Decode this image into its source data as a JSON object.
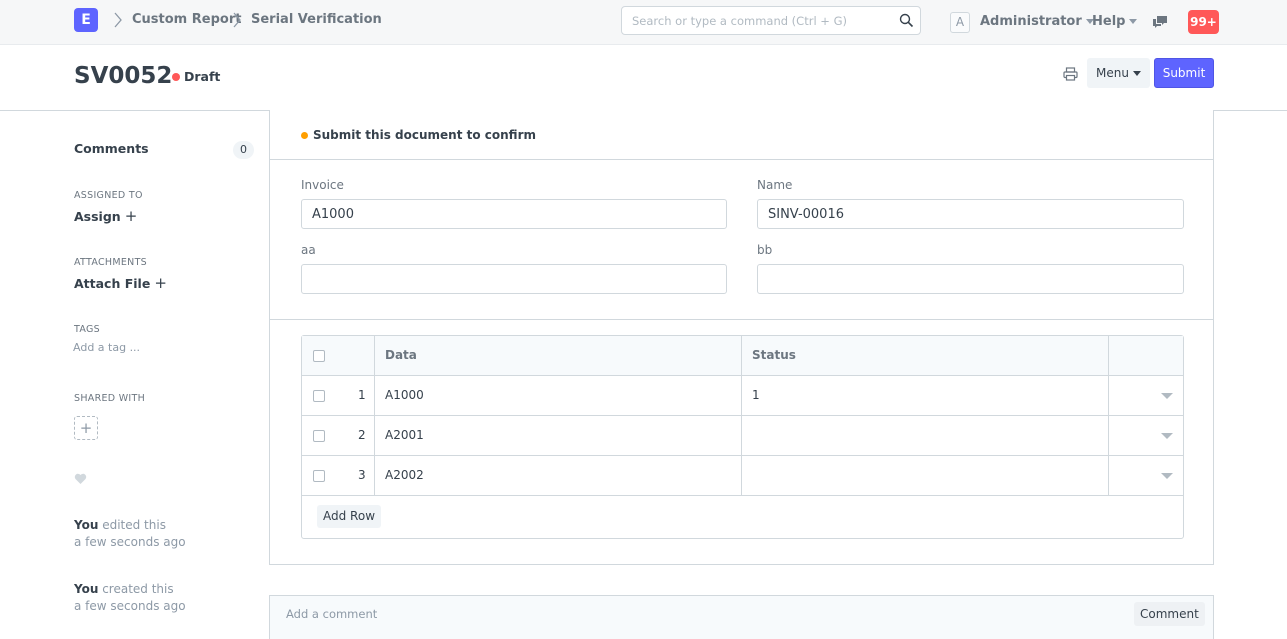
{
  "navbar": {
    "logo_letter": "E",
    "breadcrumbs": [
      "Custom Report",
      "Serial Verification"
    ],
    "search_placeholder": "Search or type a command (Ctrl + G)",
    "avatar_letter": "A",
    "user": "Administrator",
    "help": "Help",
    "notification_count": "99+"
  },
  "page": {
    "title": "SV0052",
    "status": "Draft",
    "menu_label": "Menu",
    "submit_label": "Submit"
  },
  "sidebar": {
    "comments_label": "Comments",
    "comments_count": "0",
    "assigned_to_label": "ASSIGNED TO",
    "assign_link": "Assign",
    "attachments_label": "ATTACHMENTS",
    "attach_link": "Attach File",
    "tags_label": "TAGS",
    "add_tag": "Add a tag ...",
    "shared_with_label": "SHARED WITH",
    "timeline": [
      {
        "user": "You",
        "action": " edited this",
        "time": "a few seconds ago"
      },
      {
        "user": "You",
        "action": " created this",
        "time": "a few seconds ago"
      }
    ]
  },
  "form": {
    "message": "Submit this document to confirm",
    "fields": {
      "invoice": {
        "label": "Invoice",
        "value": "A1000"
      },
      "name": {
        "label": "Name",
        "value": "SINV-00016"
      },
      "aa": {
        "label": "aa",
        "value": ""
      },
      "bb": {
        "label": "bb",
        "value": ""
      }
    },
    "grid": {
      "columns": [
        "Data",
        "Status"
      ],
      "rows": [
        {
          "idx": "1",
          "data": "A1000",
          "status": "1"
        },
        {
          "idx": "2",
          "data": "A2001",
          "status": ""
        },
        {
          "idx": "3",
          "data": "A2002",
          "status": ""
        }
      ],
      "add_row_label": "Add Row"
    }
  },
  "comment": {
    "placeholder": "Add a comment",
    "button": "Comment"
  },
  "colors": {
    "primary": "#5e64ff",
    "draft_indicator": "#ff5858",
    "message_indicator": "#ff9f00",
    "notification": "#ff5858"
  }
}
